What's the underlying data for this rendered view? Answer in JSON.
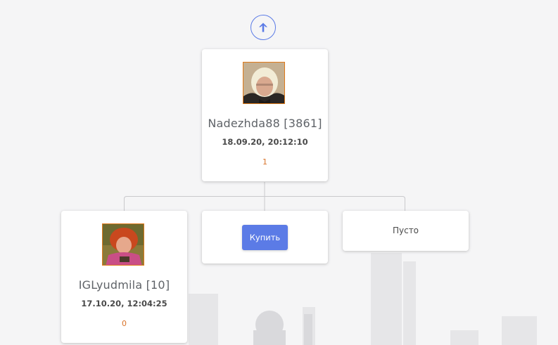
{
  "nav": {
    "up_icon": "arrow-up-icon"
  },
  "colors": {
    "accent": "#5b7be6",
    "count": "#d9742b",
    "avatar_border": "#e07a1a"
  },
  "root": {
    "username": "Nadezhda88 [3861]",
    "datetime": "18.09.20, 20:12:10",
    "count": "1"
  },
  "children": [
    {
      "username": "IGLyudmila [10]",
      "datetime": "17.10.20, 12:04:25",
      "count": "0"
    },
    {
      "buy_label": "Купить"
    },
    {
      "empty_label": "Пусто"
    }
  ]
}
